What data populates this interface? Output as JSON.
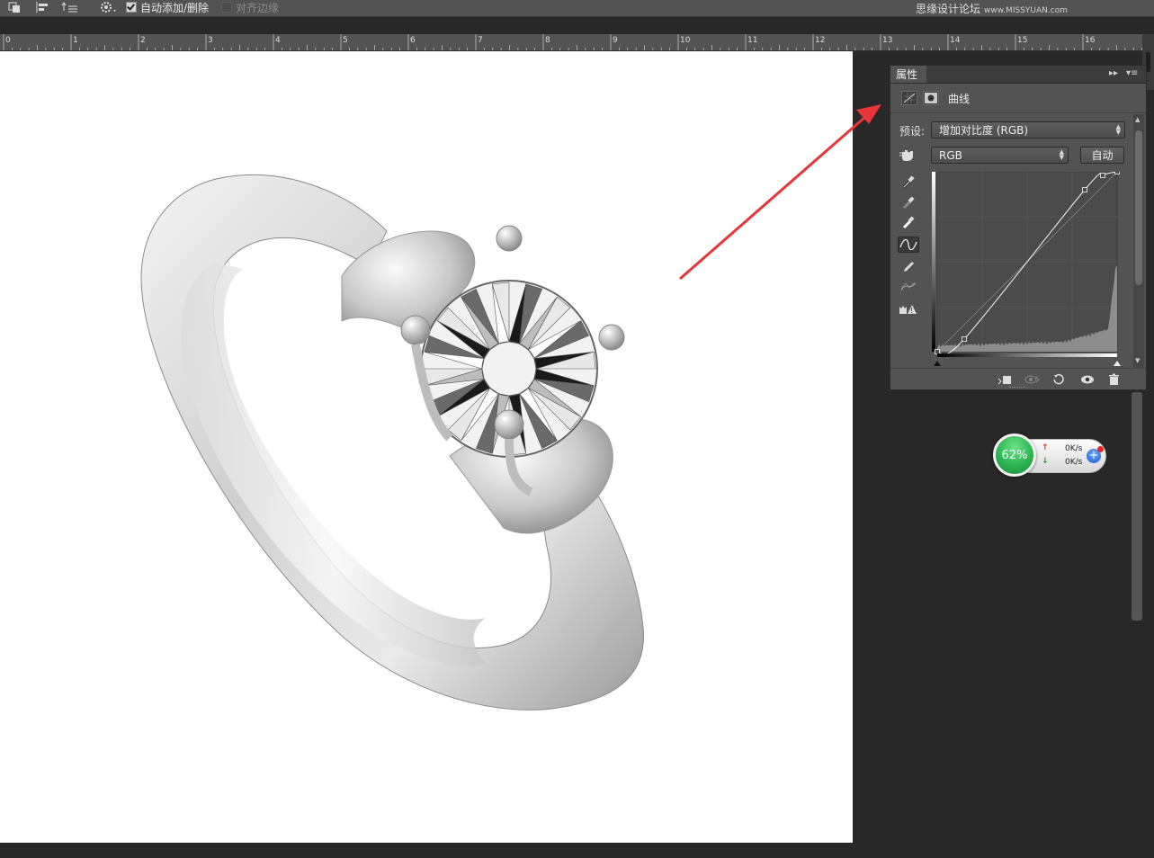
{
  "options_bar": {
    "auto_add_delete": {
      "label": "自动添加/删除",
      "checked": true
    },
    "align_edges": {
      "label": "对齐边缘",
      "checked": false
    }
  },
  "watermark": {
    "text": "思缘设计论坛",
    "url": "www.MISSYUAN.com"
  },
  "ruler": {
    "labels": [
      "0",
      "1",
      "2",
      "3",
      "4",
      "5",
      "6",
      "7",
      "8",
      "9",
      "10",
      "11",
      "12",
      "13",
      "14",
      "15",
      "16"
    ]
  },
  "properties_panel": {
    "tab_title": "属性",
    "adjustment_name": "曲线",
    "preset_label": "预设:",
    "preset_value": "增加对比度 (RGB)",
    "channel_value": "RGB",
    "auto_button": "自动",
    "curve_points": [
      [
        0,
        0
      ],
      [
        0.15,
        0.07
      ],
      [
        0.82,
        0.9
      ],
      [
        0.92,
        0.98
      ],
      [
        1,
        1
      ]
    ]
  },
  "net_widget": {
    "percent": "62%",
    "upload": "0K/s",
    "download": "0K/s"
  },
  "colors": {
    "accent_arrow": "#e8353a",
    "panel_bg": "#535353",
    "app_bg": "#282828"
  }
}
